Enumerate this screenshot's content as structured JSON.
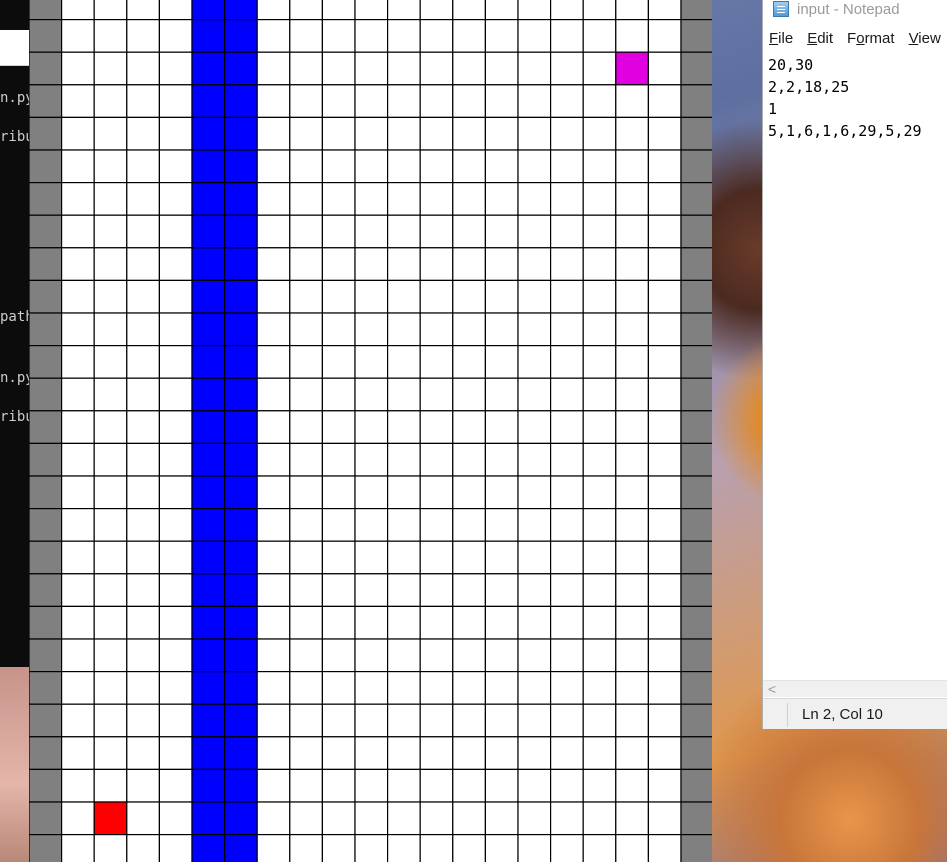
{
  "terminal": {
    "lines": [
      {
        "text": "n.py"
      },
      {
        "text": "ribu"
      },
      {
        "text": "path"
      },
      {
        "text": "n.py"
      },
      {
        "text": "ribu"
      }
    ]
  },
  "grid": {
    "columns": 21,
    "rows": 27,
    "colors": {
      "empty": "#ffffff",
      "border": "#808080",
      "wall": "#0000ff",
      "start": "#ff0000",
      "goal": "#e000e0",
      "line": "#000000"
    },
    "wall_columns": [
      5,
      6
    ],
    "border_columns": [
      0,
      20
    ],
    "start_cell": {
      "col": 2,
      "row": 25
    },
    "goal_cell": {
      "col": 18,
      "row": 2
    }
  },
  "notepad": {
    "title": "input - Notepad",
    "menu": [
      {
        "mnemonic": "F",
        "rest": "ile"
      },
      {
        "mnemonic": "E",
        "rest": "dit"
      },
      {
        "mnemonic": "o",
        "prefix": "F",
        "rest": "rmat"
      },
      {
        "mnemonic": "V",
        "rest": "iew"
      }
    ],
    "content_lines": [
      "20,30",
      "2,2,18,25",
      "1",
      "5,1,6,1,6,29,5,29"
    ],
    "status": "Ln 2, Col 10",
    "scroll_left_icon": "<"
  }
}
